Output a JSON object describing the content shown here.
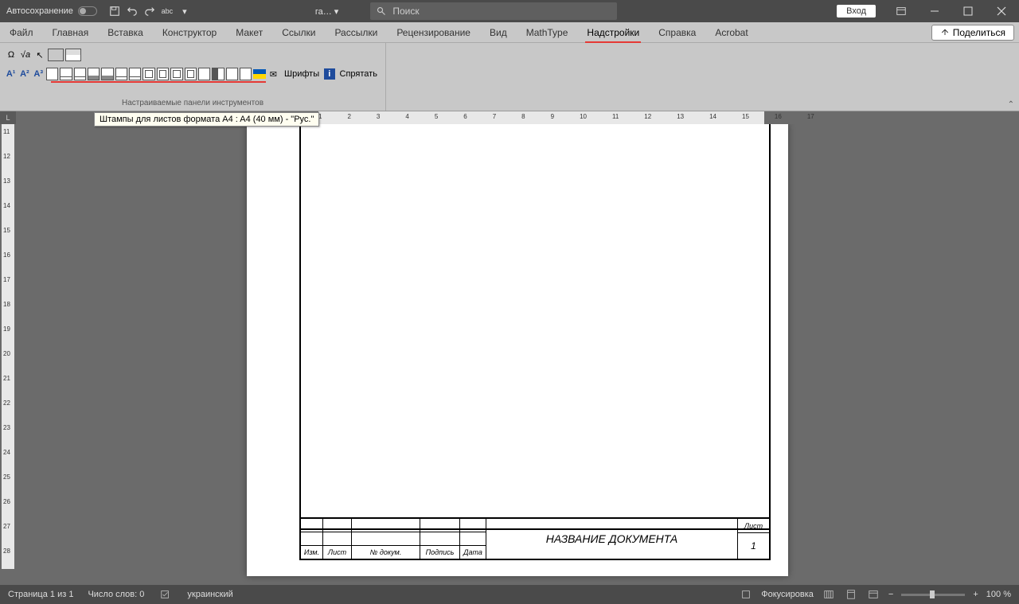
{
  "titlebar": {
    "autosave_label": "Автосохранение",
    "doc_title": "га…",
    "search_placeholder": "Поиск",
    "login_label": "Вход"
  },
  "tabs": {
    "items": [
      {
        "label": "Файл"
      },
      {
        "label": "Главная"
      },
      {
        "label": "Вставка"
      },
      {
        "label": "Конструктор"
      },
      {
        "label": "Макет"
      },
      {
        "label": "Ссылки"
      },
      {
        "label": "Рассылки"
      },
      {
        "label": "Рецензирование"
      },
      {
        "label": "Вид"
      },
      {
        "label": "MathType"
      },
      {
        "label": "Надстройки"
      },
      {
        "label": "Справка"
      },
      {
        "label": "Acrobat"
      }
    ],
    "share_label": "Поделиться"
  },
  "ribbon": {
    "fonts_label": "Шрифты",
    "hide_label": "Спрятать",
    "group_label": "Настраиваемые панели инструментов",
    "tooltip": "Штампы для листов формата A4 : A4 (40 мм) - \"Рус.\""
  },
  "ruler_h": [
    "1",
    "2",
    "3",
    "4",
    "5",
    "6",
    "7",
    "8",
    "9",
    "10",
    "11",
    "12",
    "13",
    "14",
    "15",
    "16",
    "17"
  ],
  "ruler_v": [
    "11",
    "12",
    "13",
    "14",
    "15",
    "16",
    "17",
    "18",
    "19",
    "20",
    "21",
    "22",
    "23",
    "24",
    "25",
    "26",
    "27",
    "28"
  ],
  "stamp": {
    "izm": "Изм.",
    "list": "Лист",
    "docnum": "№ докум.",
    "sign": "Подпись",
    "date": "Дата",
    "title": "НАЗВАНИЕ ДОКУМЕНТА",
    "sheet_label": "Лист",
    "sheet_num": "1"
  },
  "status": {
    "page": "Страница 1 из 1",
    "words": "Число слов: 0",
    "lang": "украинский",
    "focus": "Фокусировка",
    "zoom": "100 %"
  }
}
